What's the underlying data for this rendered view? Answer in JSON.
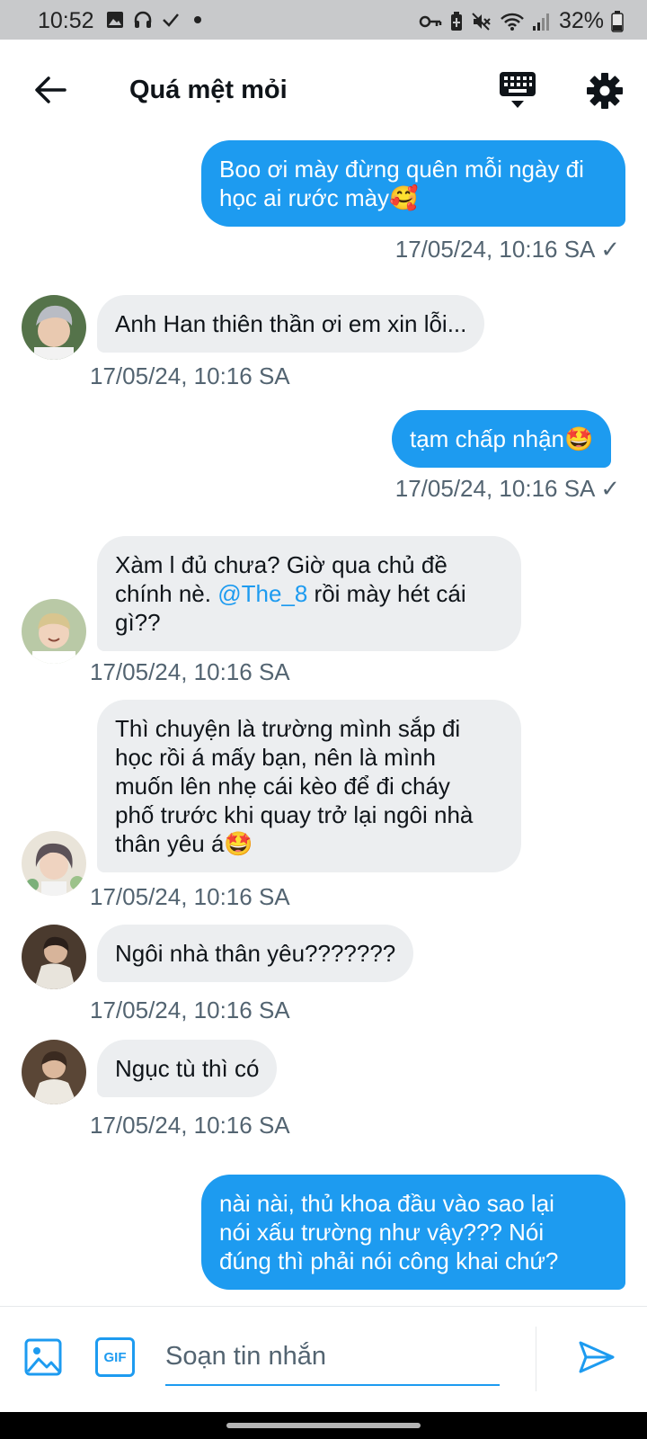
{
  "status_bar": {
    "time": "10:52",
    "battery": "32%",
    "left_icons": [
      "image-icon",
      "headset-icon",
      "check-icon",
      "dot-icon"
    ],
    "right_icons": [
      "key-icon",
      "battery-saver-icon",
      "mute-icon",
      "wifi-icon",
      "signal-icon",
      "battery-icon"
    ]
  },
  "header": {
    "title": "Quá mệt mỏi",
    "icons": [
      "back-arrow-icon",
      "keyboard-icon",
      "gear-icon"
    ]
  },
  "messages": [
    {
      "dir": "out",
      "text": "Boo ơi mày đừng quên mỗi ngày đi\nhọc ai rước mày🥰",
      "time": "17/05/24, 10:16 SA",
      "read": "✓"
    },
    {
      "dir": "in",
      "text": "Anh Han thiên thần ơi em xin lỗi...",
      "time": "17/05/24, 10:16 SA",
      "avatar": "avatar-grey-hair"
    },
    {
      "dir": "out",
      "text": "tạm chấp nhận🤩",
      "time": "17/05/24, 10:16 SA",
      "read": "✓"
    },
    {
      "dir": "in",
      "text_before": "Xàm l đủ chưa? Giờ qua chủ đề\nchính nè. ",
      "mention": "@The_8",
      "text_after": " rồi mày hét cái\ngì??",
      "time": "17/05/24, 10:16 SA",
      "avatar": "avatar-smiling"
    },
    {
      "dir": "in",
      "text": "Thì chuyện là trường mình sắp đi\nhọc rồi á mấy bạn, nên là mình\nmuốn lên nhẹ cái kèo để đi cháy\nphố trước khi quay trở lại ngôi nhà\nthân yêu á🤩",
      "time": "17/05/24, 10:16 SA",
      "avatar": "avatar-flowers"
    },
    {
      "dir": "in",
      "text": "Ngôi nhà thân yêu???????",
      "time": "17/05/24, 10:16 SA",
      "avatar": "avatar-dark-1"
    },
    {
      "dir": "in",
      "text": "Ngục tù thì có",
      "time": "17/05/24, 10:16 SA",
      "avatar": "avatar-dark-2"
    },
    {
      "dir": "out",
      "text": "nài nài, thủ khoa đầu vào sao lại\nnói xấu trường như vậy??? Nói\nđúng thì phải nói công khai chứ?"
    }
  ],
  "composer": {
    "placeholder": "Soạn tin nhắn",
    "gif_label": "GIF",
    "icons": [
      "image-icon",
      "gif-icon",
      "send-icon"
    ]
  },
  "colors": {
    "accent": "#1d9bf0",
    "incoming_bubble": "#eceef0",
    "timestamp": "#536471"
  }
}
